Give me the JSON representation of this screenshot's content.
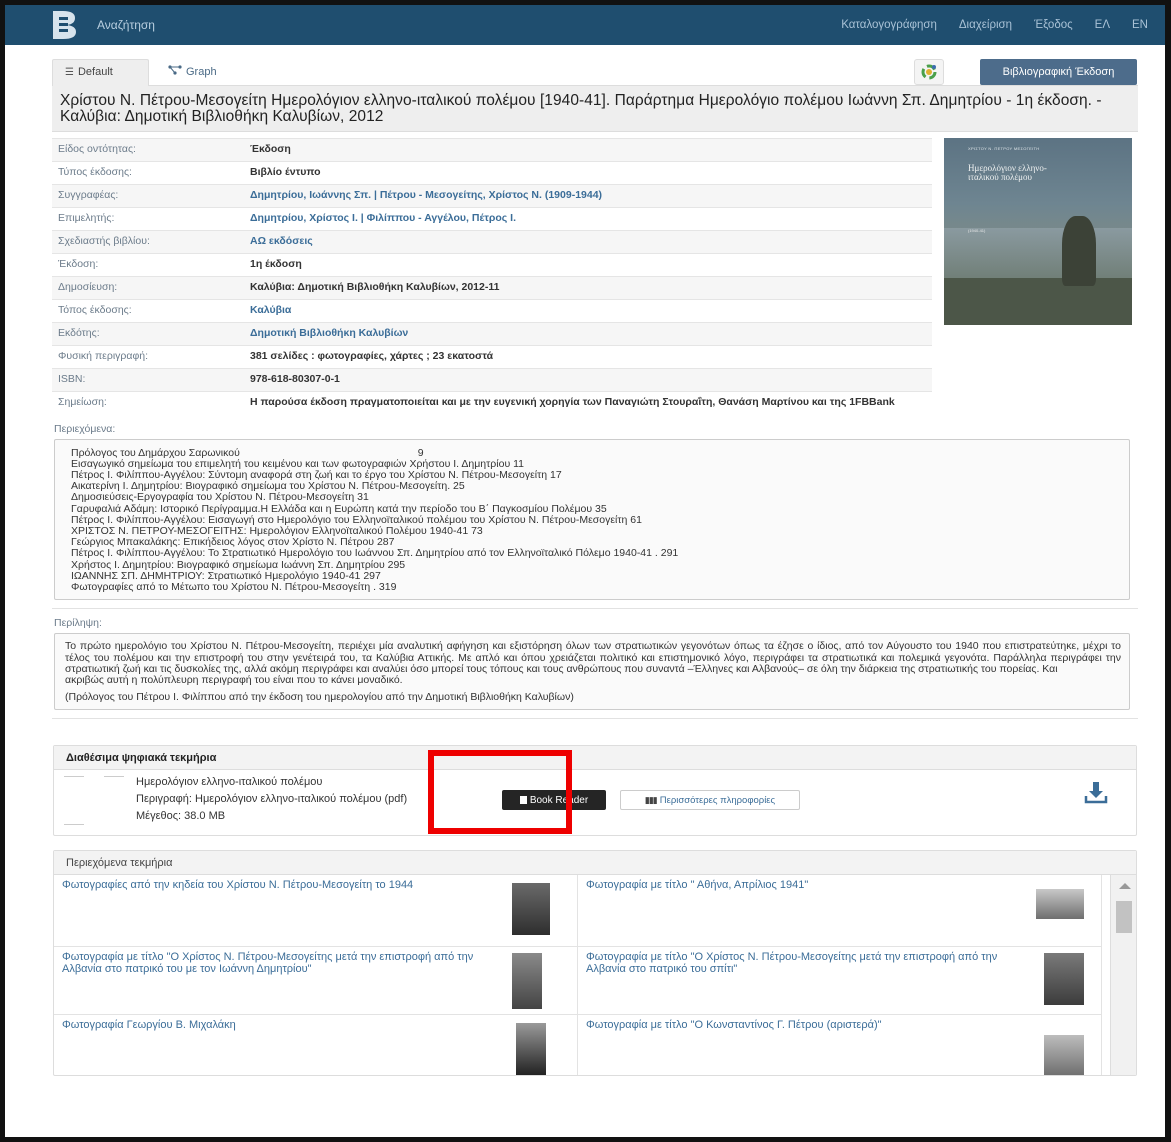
{
  "navbar": {
    "search": "Αναζήτηση",
    "items": [
      "Καταλογογράφηση",
      "Διαχείριση",
      "Έξοδος",
      "ΕΛ",
      "EN"
    ]
  },
  "tabs": {
    "default": "Default",
    "graph": "Graph"
  },
  "biblio_button": "Βιβλιογραφική Έκδοση",
  "title": "Χρίστου Ν. Πέτρου-Μεσογείτη Ημερολόγιον ελληνο-ιταλικού πολέμου [1940-41]. Παράρτημα Ημερολόγιο πολέμου Ιωάννη Σπ. Δημητρίου - 1η έκδοση. - Καλύβια: Δημοτική Βιβλιοθήκη Καλυβίων, 2012",
  "fields": [
    {
      "label": "Είδος οντότητας:",
      "value": "Έκδοση"
    },
    {
      "label": "Τύπος έκδοσης:",
      "value": "Βιβλίο έντυπο"
    },
    {
      "label": "Συγγραφέας:",
      "value": "Δημητρίου, Ιωάννης Σπ. | Πέτρου - Μεσογείτης, Χρίστος Ν. (1909-1944)"
    },
    {
      "label": "Επιμελητής:",
      "value": "Δημητρίου, Χρίστος Ι. | Φιλίππου - Αγγέλου, Πέτρος Ι."
    },
    {
      "label": "Σχεδιαστής βιβλίου:",
      "value": "ΑΩ εκδόσεις"
    },
    {
      "label": "Έκδοση:",
      "value": "1η έκδοση"
    },
    {
      "label": "Δημοσίευση:",
      "value": "Καλύβια: Δημοτική Βιβλιοθήκη Καλυβίων, 2012-11"
    },
    {
      "label": "Τόπος έκδοσης:",
      "value": "Καλύβια"
    },
    {
      "label": "Εκδότης:",
      "value": "Δημοτική Βιβλιοθήκη Καλυβίων"
    },
    {
      "label": "Φυσική περιγραφή:",
      "value": "381 σελίδες : φωτογραφίες, χάρτες ; 23 εκατοστά"
    },
    {
      "label": "ISBN:",
      "value": "978-618-80307-0-1"
    },
    {
      "label": "Σημείωση:",
      "value": "Η παρούσα έκδοση πραγματοποιείται και με την ευγενική χορηγία των Παναγιώτη Στουραΐτη, Θανάση Μαρτίνου και της 1FBBank"
    }
  ],
  "cover": {
    "line1": "ΧΡΙΣΤΟΥ Ν. ΠΕΤΡΟΥ ΜΕΣΟΓΕΙΤΗ",
    "line2": "Ημερολόγιον ελληνο-ιταλικού πολέμου",
    "line3": "(1940-41)"
  },
  "contents": {
    "label": "Περιεχόμενα:",
    "lines": [
      "Πρόλογος του Δημάρχου Σαρωνικού                                                             9",
      "Εισαγωγικό σημείωμα του επιμελητή του κειμένου και των φωτογραφιών Χρήστου Ι. Δημητρίου 11",
      "Πέτρος Ι. Φιλίππου-Αγγέλου: Σύντομη αναφορά στη ζωή και το έργο του Χρίστου Ν. Πέτρου-Μεσογείτη 17",
      "Αικατερίνη Ι. Δημητρίου: Βιογραφικό σημείωμα του Χρίστου Ν. Πέτρου-Μεσογείτη. 25",
      "Δημοσιεύσεις-Εργογραφία του Χρίστου Ν. Πέτρου-Μεσογείτη 31",
      "Γαρυφαλιά Αδάμη: Ιστορικό Περίγραμμα.Η Ελλάδα και η Ευρώπη κατά την περίοδο του Β΄ Παγκοσμίου Πολέμου 35",
      "Πέτρος Ι. Φιλίππου-Αγγέλου: Εισαγωγή στο Ημερολόγιο του Ελληνοϊταλικού πολέμου του Χρίστου Ν. Πέτρου-Μεσογείτη 61",
      "ΧΡΙΣΤΟΣ Ν. ΠΕΤΡΟΥ-ΜΕΣΟΓΕΙΤΗΣ: Ημερολόγιον Ελληνοϊταλικού Πολέμου 1940-41 73",
      "Γεώργιος Μπακαλάκης: Επικήδειος λόγος στον Χρίστο Ν. Πέτρου 287",
      "Πέτρος Ι. Φιλίππου-Αγγέλου: Το Στρατιωτικό Ημερολόγιο του Ιωάννου Σπ. Δημητρίου από τον Ελληνοϊταλικό Πόλεμο 1940-41 . 291",
      "Χρήστος Ι. Δημητρίου: Βιογραφικό σημείωμα Ιωάννη Σπ. Δημητρίου 295",
      "ΙΩΑΝΝΗΣ ΣΠ. ΔΗΜΗΤΡΙΟΥ: Στρατιωτικό Ημερολόγιο 1940-41 297",
      "Φωτογραφίες από το Μέτωπο του Χρίστου Ν. Πέτρου-Μεσογείτη . 319"
    ]
  },
  "summary": {
    "label": "Περίληψη:",
    "text": "Το πρώτο ημερολόγιο του Χρίστου Ν. Πέτρου-Μεσογείτη, περιέχει μία αναλυτική αφήγηση και εξιστόρηση όλων των στρατιωτικών γεγονότων όπως τα έζησε ο ίδιος, από τον Αύγουστο του 1940 που επιστρατεύτηκε, μέχρι το τέλος του πολέμου και την επιστροφή του στην γενέτειρά του, τα Καλύβια Αττικής. Με απλό και όπου χρειάζεται πολιτικό και επιστημονικό λόγο, περιγράφει τα στρατιωτικά και πολεμικά γεγονότα. Παράλληλα περιγράφει την στρατιωτική ζωή και τις δυσκολίες της, αλλά ακόμη περιγράφει και αναλύει όσο μπορεί τους τόπους και τους ανθρώπους που συναντά –Έλληνες και Αλβανούς– σε όλη την διάρκεια της στρατιωτικής του πορείας. Και",
    "text2": "ακριβώς αυτή η πολύπλευρη περιγραφή του είναι που το κάνει μοναδικό.",
    "note": "(Πρόλογος του Πέτρου Ι. Φιλίππου από την έκδοση του ημερολογίου από την Δημοτική Βιβλιοθήκη Καλυβίων)"
  },
  "digital": {
    "heading": "Διαθέσιμα ψηφιακά τεκμήρια",
    "title": "Ημερολόγιον ελληνο-ιταλικού πολέμου",
    "description": "Περιγραφή: Ημερολόγιον ελληνο-ιταλικού πολέμου (pdf)",
    "size": "Μέγεθος: 38.0 MB",
    "book_reader": "Book Reader",
    "more_info": "Περισσότερες πληροφορίες"
  },
  "contained": {
    "heading": "Περιεχόμενα τεκμήρια",
    "items": [
      "Φωτογραφίες από την κηδεία του Χρίστου Ν. Πέτρου-Μεσογείτη το 1944",
      "Φωτογραφία με τίτλο \" Αθήνα, Απρίλιος 1941\"",
      "Φωτογραφία με τίτλο \"Ο Χρίστος Ν. Πέτρου-Μεσογείτης μετά την επιστροφή από την Αλβανία στο πατρικό του με τον Ιωάννη Δημητρίου\"",
      "Φωτογραφία με τίτλο \"Ο Χρίστος Ν. Πέτρου-Μεσογείτης μετά την επιστροφή από την Αλβανία στο πατρικό του σπίτι\"",
      "Φωτογραφία Γεωργίου Β. Μιχαλάκη",
      "Φωτογραφία με τίτλο \"Ο Κωνσταντίνος Γ. Πέτρου (αριστερά)\""
    ]
  },
  "colors": {
    "navbar": "#1f4e6f",
    "accent_button": "#4d6c8b",
    "link": "#3b6d98",
    "highlight": "#ee0000"
  }
}
